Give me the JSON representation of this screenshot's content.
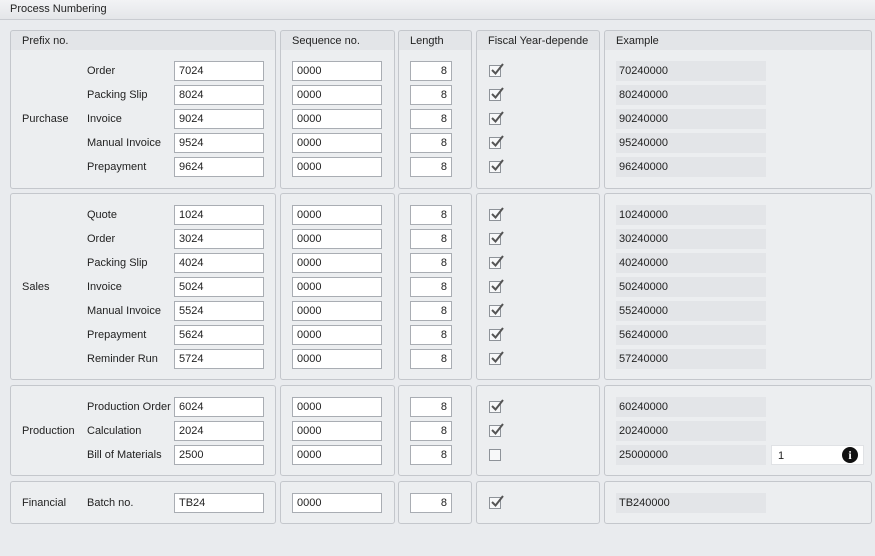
{
  "window": {
    "title": "Process Numbering"
  },
  "columns": {
    "prefix": "Prefix no.",
    "sequence": "Sequence no.",
    "length": "Length",
    "fiscal": "Fiscal Year-depende",
    "example": "Example"
  },
  "groups": [
    {
      "label": "Purchase",
      "rows": [
        {
          "label": "Order",
          "prefix": "7024",
          "sequence": "0000",
          "length": "8",
          "fiscal": true,
          "example": "70240000"
        },
        {
          "label": "Packing Slip",
          "prefix": "8024",
          "sequence": "0000",
          "length": "8",
          "fiscal": true,
          "example": "80240000"
        },
        {
          "label": "Invoice",
          "prefix": "9024",
          "sequence": "0000",
          "length": "8",
          "fiscal": true,
          "example": "90240000"
        },
        {
          "label": "Manual Invoice",
          "prefix": "9524",
          "sequence": "0000",
          "length": "8",
          "fiscal": true,
          "example": "95240000"
        },
        {
          "label": "Prepayment",
          "prefix": "9624",
          "sequence": "0000",
          "length": "8",
          "fiscal": true,
          "example": "96240000"
        }
      ]
    },
    {
      "label": "Sales",
      "rows": [
        {
          "label": "Quote",
          "prefix": "1024",
          "sequence": "0000",
          "length": "8",
          "fiscal": true,
          "example": "10240000"
        },
        {
          "label": "Order",
          "prefix": "3024",
          "sequence": "0000",
          "length": "8",
          "fiscal": true,
          "example": "30240000"
        },
        {
          "label": "Packing Slip",
          "prefix": "4024",
          "sequence": "0000",
          "length": "8",
          "fiscal": true,
          "example": "40240000"
        },
        {
          "label": "Invoice",
          "prefix": "5024",
          "sequence": "0000",
          "length": "8",
          "fiscal": true,
          "example": "50240000"
        },
        {
          "label": "Manual Invoice",
          "prefix": "5524",
          "sequence": "0000",
          "length": "8",
          "fiscal": true,
          "example": "55240000"
        },
        {
          "label": "Prepayment",
          "prefix": "5624",
          "sequence": "0000",
          "length": "8",
          "fiscal": true,
          "example": "56240000"
        },
        {
          "label": "Reminder Run",
          "prefix": "5724",
          "sequence": "0000",
          "length": "8",
          "fiscal": true,
          "example": "57240000"
        }
      ]
    },
    {
      "label": "Production",
      "rows": [
        {
          "label": "Production Order",
          "prefix": "6024",
          "sequence": "0000",
          "length": "8",
          "fiscal": true,
          "example": "60240000"
        },
        {
          "label": "Calculation",
          "prefix": "2024",
          "sequence": "0000",
          "length": "8",
          "fiscal": true,
          "example": "20240000"
        },
        {
          "label": "Bill of Materials",
          "prefix": "2500",
          "sequence": "0000",
          "length": "8",
          "fiscal": false,
          "example": "25000000"
        }
      ]
    },
    {
      "label": "Financial",
      "rows": [
        {
          "label": "Batch no.",
          "prefix": "TB24",
          "sequence": "0000",
          "length": "8",
          "fiscal": true,
          "example": "TB240000"
        }
      ]
    }
  ],
  "extra": {
    "value": "1",
    "icon": "info-icon"
  }
}
